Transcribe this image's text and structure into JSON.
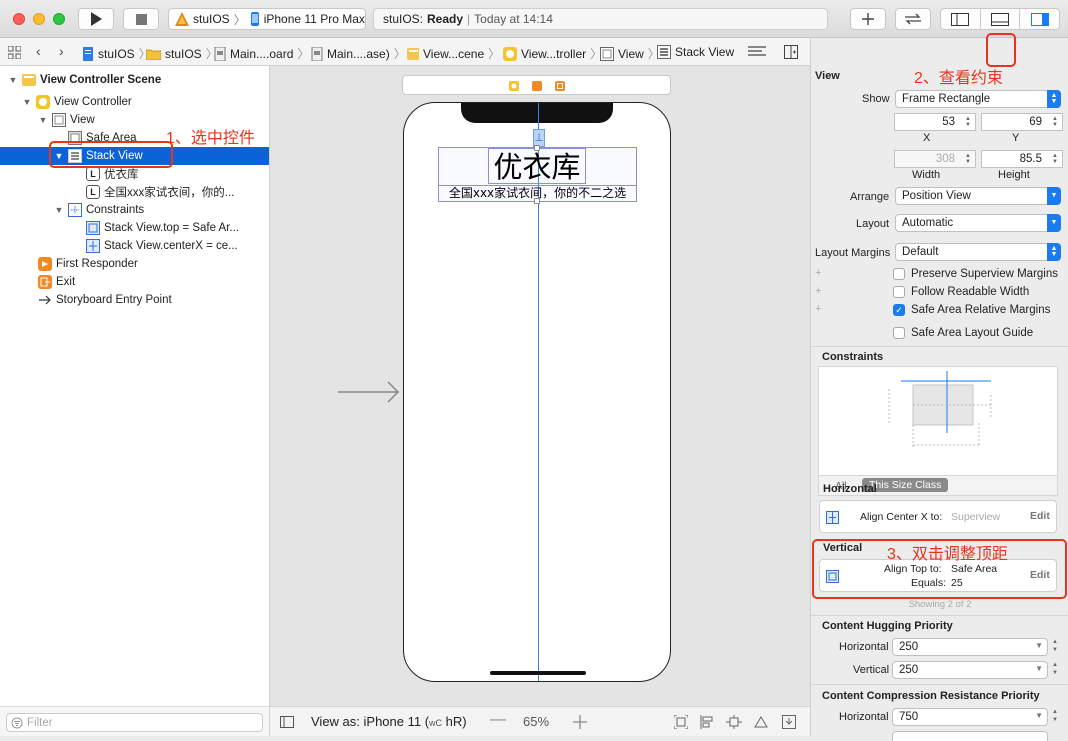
{
  "toolbar": {
    "scheme": "stuIOS",
    "device": "iPhone 11 Pro Max",
    "status_project": "stuIOS:",
    "status_state": "Ready",
    "status_time": "Today at 14:14"
  },
  "jumpbar": {
    "crumbs": [
      "stuIOS",
      "stuIOS",
      "Main....oard",
      "Main....ase)",
      "View...cene",
      "View...troller",
      "View",
      "Stack View"
    ]
  },
  "navigator": {
    "rows": [
      {
        "label": "View Controller Scene"
      },
      {
        "label": "View Controller"
      },
      {
        "label": "View"
      },
      {
        "label": "Safe Area"
      },
      {
        "label": "Stack View"
      },
      {
        "label": "优衣库"
      },
      {
        "label": "全国xxx家试衣间，你的..."
      },
      {
        "label": "Constraints"
      },
      {
        "label": "Stack View.top = Safe Ar..."
      },
      {
        "label": "Stack View.centerX = ce..."
      },
      {
        "label": "First Responder"
      },
      {
        "label": "Exit"
      },
      {
        "label": "Storyboard Entry Point"
      }
    ],
    "filter_placeholder": "Filter"
  },
  "canvas": {
    "title_label": "优衣库",
    "subtitle_label": "全国xxx家试衣间，你的不二之选",
    "view_as": "View as: iPhone 11 (",
    "size_w": "wC",
    "size_h": "hR)",
    "zoom": "65%"
  },
  "annotations": {
    "step1": "1、选中控件",
    "step2": "2、查看约束",
    "step3": "3、双击调整顶距"
  },
  "inspector": {
    "section_title": "View",
    "show_label": "Show",
    "show_value": "Frame Rectangle",
    "x_value": "53",
    "y_value": "69",
    "x_label": "X",
    "y_label": "Y",
    "width_value": "308",
    "height_value": "85.5",
    "width_label": "Width",
    "height_label": "Height",
    "arrange_label": "Arrange",
    "arrange_value": "Position View",
    "layout_label": "Layout",
    "layout_value": "Automatic",
    "margins_label": "Layout Margins",
    "margins_value": "Default",
    "check1": "Preserve Superview Margins",
    "check2": "Follow Readable Width",
    "check3": "Safe Area Relative Margins",
    "check4": "Safe Area Layout Guide",
    "constraints_title": "Constraints",
    "tab_all": "All",
    "tab_size_class": "This Size Class",
    "horizontal_title": "Horizontal",
    "h_constraint": "Align Center X to:",
    "h_target": "Superview",
    "edit": "Edit",
    "vertical_title": "Vertical",
    "v_constraint": "Align Top to:",
    "v_target": "Safe Area",
    "v_equals_label": "Equals:",
    "v_equals_value": "25",
    "showing": "Showing 2 of 2",
    "hugging_title": "Content Hugging Priority",
    "hug_h_label": "Horizontal",
    "hug_h_value": "250",
    "hug_v_label": "Vertical",
    "hug_v_value": "250",
    "compression_title": "Content Compression Resistance Priority",
    "comp_h_label": "Horizontal",
    "comp_h_value": "750"
  },
  "colors": {
    "selection": "#0b63d7",
    "accent": "#1a7cf0",
    "annotation": "#e8341c"
  }
}
